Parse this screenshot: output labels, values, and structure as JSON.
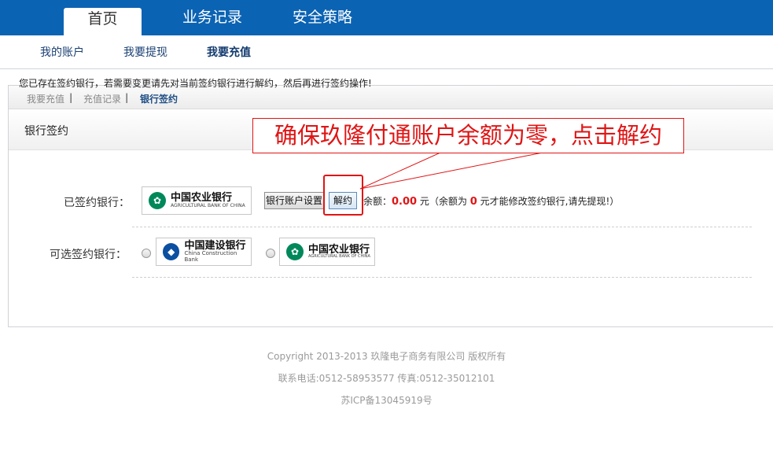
{
  "top_nav": [
    {
      "label": "首页",
      "active": true
    },
    {
      "label": "业务记录",
      "active": false
    },
    {
      "label": "安全策略",
      "active": false
    }
  ],
  "sub_nav": [
    {
      "label": "我的账户"
    },
    {
      "label": "我要提现"
    },
    {
      "label": "我要充值",
      "active": true
    }
  ],
  "breadcrumb": {
    "items": [
      "我要充值",
      "充值记录",
      "银行签约"
    ],
    "separator": "|"
  },
  "section_title": "银行签约",
  "notice": "您已存在签约银行，若需要变更请先对当前签约银行进行解约，然后再进行签约操作!",
  "signed": {
    "label": "已签约银行：",
    "bank": {
      "cn": "中国农业银行",
      "en": "AGRICULTURAL BANK OF CHINA",
      "color": "#00885a"
    },
    "settings_button": "银行账户设置",
    "cancel_button": "解约",
    "balance_prefix": "余额：",
    "balance_value": "0.00",
    "balance_unit": "元",
    "note_prefix": "（余额为",
    "note_value": "0",
    "note_suffix": "元才能修改签约银行,请先提现!）"
  },
  "selectable": {
    "label": "可选签约银行：",
    "banks": [
      {
        "cn": "中国建设银行",
        "en": "China Construction Bank",
        "color": "#0b4fa0"
      },
      {
        "cn": "中国农业银行",
        "en": "AGRICULTURAL BANK OF CHINA",
        "color": "#00885a"
      }
    ]
  },
  "annotation": "确保玖隆付通账户余额为零，点击解约",
  "colors": {
    "nav_blue": "#0b63b3",
    "highlight_red": "#e01515"
  },
  "footer": {
    "copyright": "Copyright 2013-2013 玖隆电子商务有限公司 版权所有",
    "contact": "联系电话:0512-58953577 传真:0512-35012101",
    "icp": "苏ICP备13045919号"
  }
}
